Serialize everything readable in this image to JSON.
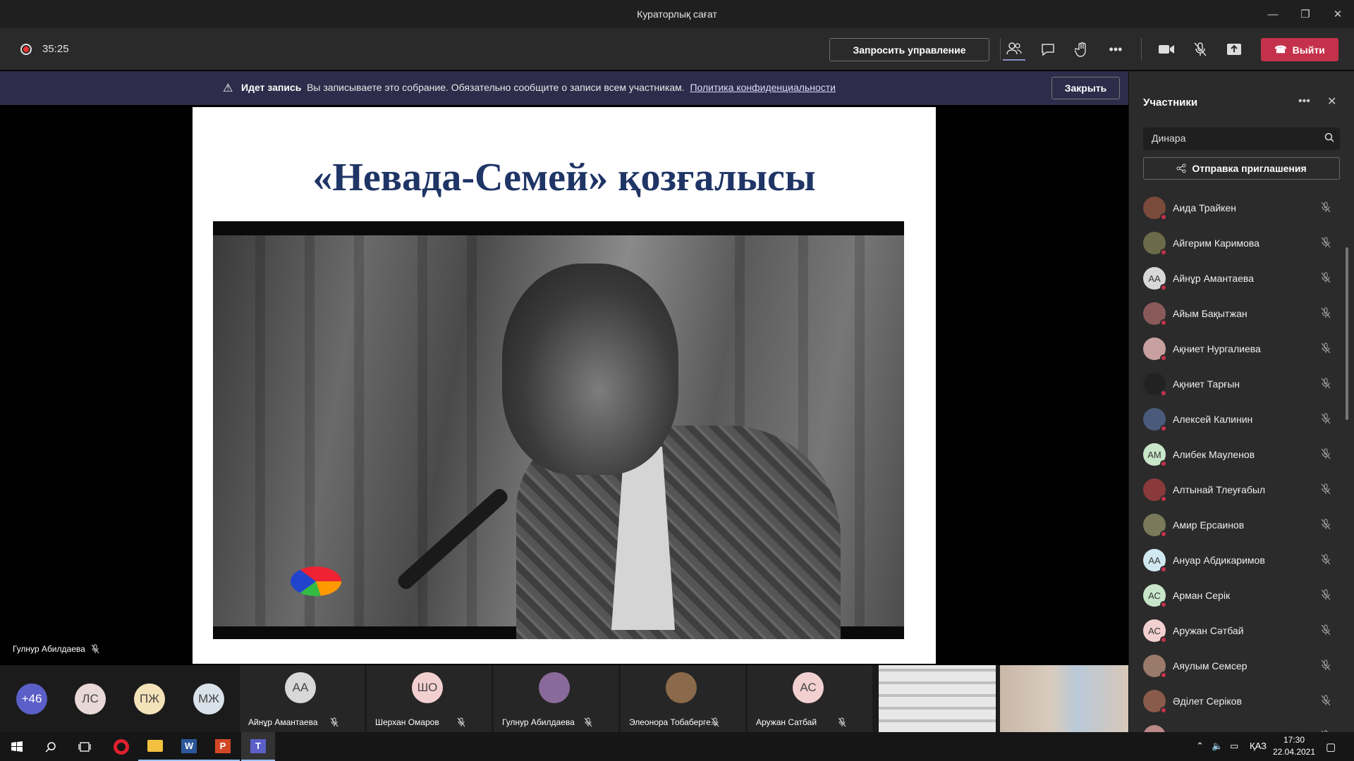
{
  "window": {
    "title": "Кураторлық сағат",
    "controls": [
      "—",
      "❐",
      "✕"
    ]
  },
  "toolbar": {
    "timer": "35:25",
    "request_control": "Запросить управление",
    "leave": "Выйти",
    "icons": [
      "people-icon",
      "chat-icon",
      "raise-hand-icon",
      "more-icon",
      "camera-icon",
      "mic-off-icon",
      "share-icon"
    ]
  },
  "banner": {
    "bold": "Идет запись",
    "text": "Вы записываете это собрание. Обязательно сообщите о записи всем участникам.",
    "link": "Политика конфиденциальности",
    "close": "Закрыть"
  },
  "slide": {
    "title": "«Невада-Семей» қозғалысы"
  },
  "presenter": {
    "name": "Гулнур Абилдаева"
  },
  "panel": {
    "title": "Участники",
    "search_value": "Динара",
    "invite": "Отправка приглашения",
    "participants": [
      {
        "name": "Аида Трайкен",
        "initials": "",
        "color": "#7a4a3a"
      },
      {
        "name": "Айгерим Каримова",
        "initials": "",
        "color": "#6b6b4a"
      },
      {
        "name": "Айнұр Амантаева",
        "initials": "АА",
        "color": "#d8d8d8"
      },
      {
        "name": "Айым Бақытжан",
        "initials": "",
        "color": "#8a5a5a"
      },
      {
        "name": "Ақниет Нургалиева",
        "initials": "",
        "color": "#c9a0a0"
      },
      {
        "name": "Ақниет Тарғын",
        "initials": "",
        "color": "#222222"
      },
      {
        "name": "Алексей Калинин",
        "initials": "",
        "color": "#4a5a7a"
      },
      {
        "name": "Алибек Мауленов",
        "initials": "АМ",
        "color": "#c8e6c9"
      },
      {
        "name": "Алтынай Тлеуғабыл",
        "initials": "",
        "color": "#8a3a3a"
      },
      {
        "name": "Амир Ерсаинов",
        "initials": "",
        "color": "#7a7a5a"
      },
      {
        "name": "Ануар Абдикаримов",
        "initials": "АА",
        "color": "#d0e8f0"
      },
      {
        "name": "Арман Серік",
        "initials": "АС",
        "color": "#c8e6c9"
      },
      {
        "name": "Аружан Сәтбай",
        "initials": "АС",
        "color": "#f3d0d0"
      },
      {
        "name": "Аяулым Семсер",
        "initials": "",
        "color": "#9a7a6a"
      },
      {
        "name": "Әділет Серіков",
        "initials": "",
        "color": "#8a5a4a"
      },
      {
        "name": "",
        "initials": "",
        "color": "#b88"
      }
    ]
  },
  "strip": {
    "overflow": "+46",
    "small_avatars": [
      {
        "initials": "ЛС",
        "color": "#e8d8d8"
      },
      {
        "initials": "ПЖ",
        "color": "#f4e2b8"
      },
      {
        "initials": "МЖ",
        "color": "#d9e2ea"
      }
    ],
    "tiles": [
      {
        "name": "Айнұр Амантаева",
        "initials": "АА",
        "color": "#d8d8d8"
      },
      {
        "name": "Шерхан Омаров",
        "initials": "ШО",
        "color": "#f3d0d0"
      },
      {
        "name": "Гулнур Абилдаева",
        "initials": "",
        "color": "#8a6a9a"
      },
      {
        "name": "Элеонора Тобаберге...",
        "initials": "",
        "color": "#8a6a4a"
      },
      {
        "name": "Аружан Сатбай",
        "initials": "АС",
        "color": "#f3d0d0"
      }
    ]
  },
  "taskbar": {
    "lang": "ҚАЗ",
    "time": "17:30",
    "date": "22.04.2021",
    "apps": [
      "windows-icon",
      "search-icon",
      "task-view-icon",
      "opera-icon",
      "explorer-icon",
      "word-icon",
      "powerpoint-icon",
      "teams-icon"
    ]
  }
}
